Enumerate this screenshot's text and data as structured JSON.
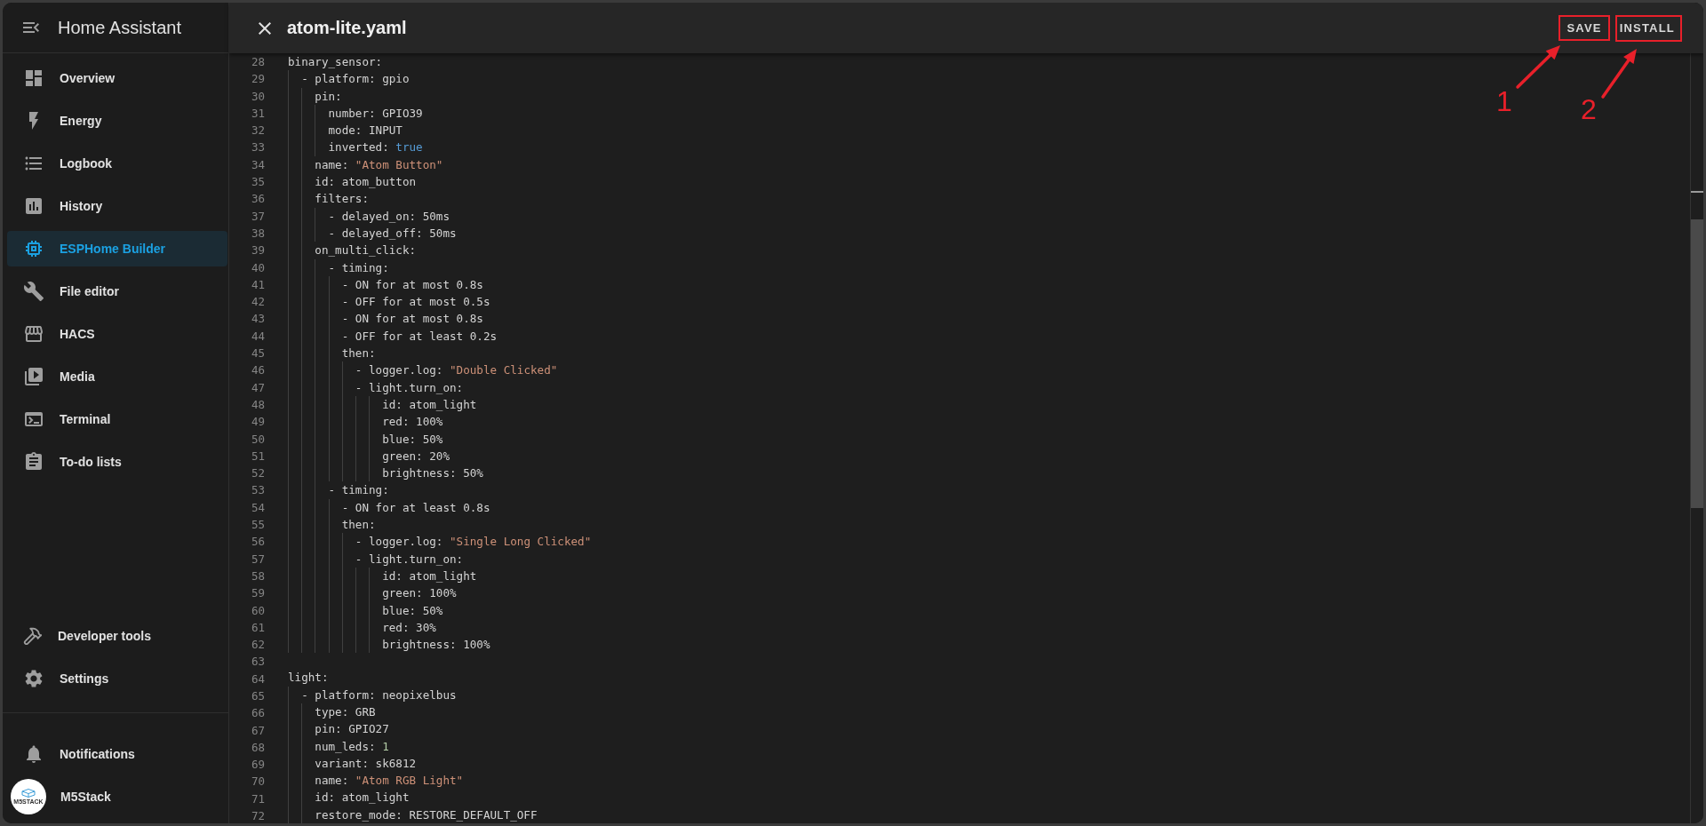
{
  "sidebar": {
    "title": "Home Assistant",
    "items": [
      {
        "label": "Overview",
        "kind": "dashboard",
        "selected": false
      },
      {
        "label": "Energy",
        "kind": "bolt",
        "selected": false
      },
      {
        "label": "Logbook",
        "kind": "list",
        "selected": false
      },
      {
        "label": "History",
        "kind": "chart",
        "selected": false
      },
      {
        "label": "ESPHome Builder",
        "kind": "chip",
        "selected": true
      },
      {
        "label": "File editor",
        "kind": "wrench",
        "selected": false
      },
      {
        "label": "HACS",
        "kind": "store",
        "selected": false
      },
      {
        "label": "Media",
        "kind": "media",
        "selected": false
      },
      {
        "label": "Terminal",
        "kind": "terminal",
        "selected": false
      },
      {
        "label": "To-do lists",
        "kind": "clipboard",
        "selected": false
      }
    ],
    "bottom_items": [
      {
        "label": "Developer tools",
        "kind": "hammer",
        "selected": false
      },
      {
        "label": "Settings",
        "kind": "gear",
        "selected": false
      }
    ],
    "notifications": {
      "label": "Notifications"
    },
    "user": {
      "name": "M5Stack",
      "avatar_text": "M5STACK"
    }
  },
  "editor": {
    "title": "atom-lite.yaml",
    "actions": [
      {
        "label": "SAVE",
        "annotation": "1"
      },
      {
        "label": "INSTALL",
        "annotation": "2"
      }
    ],
    "lines": [
      {
        "number": "28",
        "text": "binary_sensor:"
      },
      {
        "number": "29",
        "text": "  - platform: gpio"
      },
      {
        "number": "30",
        "text": "    pin:"
      },
      {
        "number": "31",
        "text": "      number: GPIO39"
      },
      {
        "number": "32",
        "text": "      mode: INPUT"
      },
      {
        "number": "33",
        "text": "      inverted: ",
        "value": "true",
        "kind": "boolean"
      },
      {
        "number": "34",
        "text": "    name: ",
        "value": "\"Atom Button\"",
        "kind": "string"
      },
      {
        "number": "35",
        "text": "    id: atom_button"
      },
      {
        "number": "36",
        "text": "    filters:"
      },
      {
        "number": "37",
        "text": "      - delayed_on: 50ms"
      },
      {
        "number": "38",
        "text": "      - delayed_off: 50ms"
      },
      {
        "number": "39",
        "text": "    on_multi_click:"
      },
      {
        "number": "40",
        "text": "      - timing:"
      },
      {
        "number": "41",
        "text": "        - ON for at most 0.8s"
      },
      {
        "number": "42",
        "text": "        - OFF for at most 0.5s"
      },
      {
        "number": "43",
        "text": "        - ON for at most 0.8s"
      },
      {
        "number": "44",
        "text": "        - OFF for at least 0.2s"
      },
      {
        "number": "45",
        "text": "        then:"
      },
      {
        "number": "46",
        "text": "          - logger.log: ",
        "value": "\"Double Clicked\"",
        "kind": "string"
      },
      {
        "number": "47",
        "text": "          - light.turn_on:"
      },
      {
        "number": "48",
        "text": "              id: atom_light"
      },
      {
        "number": "49",
        "text": "              red: 100%"
      },
      {
        "number": "50",
        "text": "              blue: 50%"
      },
      {
        "number": "51",
        "text": "              green: 20%"
      },
      {
        "number": "52",
        "text": "              brightness: 50%"
      },
      {
        "number": "53",
        "text": "      - timing:"
      },
      {
        "number": "54",
        "text": "        - ON for at least 0.8s"
      },
      {
        "number": "55",
        "text": "        then:"
      },
      {
        "number": "56",
        "text": "          - logger.log: ",
        "value": "\"Single Long Clicked\"",
        "kind": "string"
      },
      {
        "number": "57",
        "text": "          - light.turn_on:"
      },
      {
        "number": "58",
        "text": "              id: atom_light"
      },
      {
        "number": "59",
        "text": "              green: 100%"
      },
      {
        "number": "60",
        "text": "              blue: 50%"
      },
      {
        "number": "61",
        "text": "              red: 30%"
      },
      {
        "number": "62",
        "text": "              brightness: 100%"
      },
      {
        "number": "63"
      },
      {
        "number": "64",
        "text": "light:"
      },
      {
        "number": "65",
        "text": "  - platform: neopixelbus"
      },
      {
        "number": "66",
        "text": "    type: GRB"
      },
      {
        "number": "67",
        "text": "    pin: GPIO27"
      },
      {
        "number": "68",
        "text": "    num_leds: ",
        "value": "1",
        "kind": "number"
      },
      {
        "number": "69",
        "text": "    variant: sk6812"
      },
      {
        "number": "70",
        "text": "    name: ",
        "value": "\"Atom RGB Light\"",
        "kind": "string"
      },
      {
        "number": "71",
        "text": "    id: atom_light"
      },
      {
        "number": "72",
        "text": "    restore_mode: RESTORE_DEFAULT_OFF"
      }
    ]
  }
}
